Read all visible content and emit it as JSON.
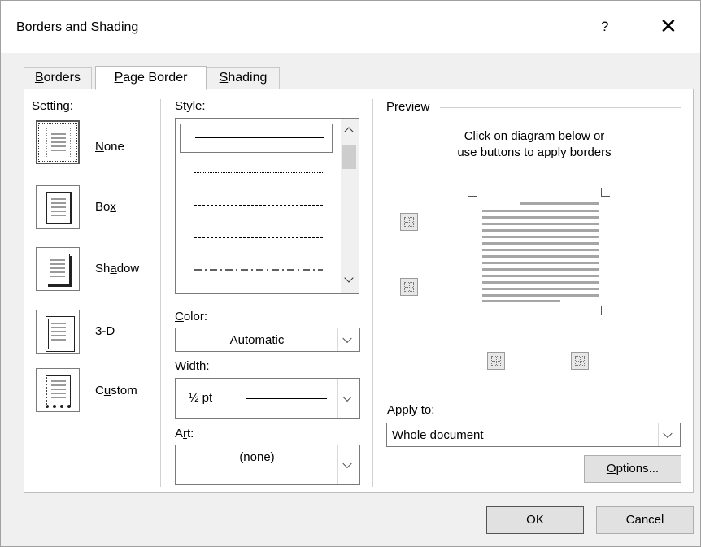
{
  "dialog": {
    "title": "Borders and Shading",
    "help_label": "?",
    "close_label": "✕"
  },
  "tabs": [
    {
      "label_pre": "",
      "label_key": "B",
      "label_post": "orders",
      "active": false
    },
    {
      "label_pre": "",
      "label_key": "P",
      "label_post": "age Border",
      "active": true
    },
    {
      "label_pre": "",
      "label_key": "S",
      "label_post": "hading",
      "active": false
    }
  ],
  "setting": {
    "label": "Setting:",
    "options": [
      {
        "pre": "",
        "key": "N",
        "post": "one",
        "icon": "setting-none-icon",
        "selected": true
      },
      {
        "pre": "Bo",
        "key": "x",
        "post": "",
        "icon": "setting-box-icon",
        "selected": false
      },
      {
        "pre": "Sh",
        "key": "a",
        "post": "dow",
        "icon": "setting-shadow-icon",
        "selected": false
      },
      {
        "pre": "3-",
        "key": "D",
        "post": "",
        "icon": "setting-3d-icon",
        "selected": false
      },
      {
        "pre": "C",
        "key": "u",
        "post": "stom",
        "icon": "setting-custom-icon",
        "selected": false
      }
    ]
  },
  "style": {
    "label_pre": "St",
    "label_key": "y",
    "label_post": "le:",
    "items": [
      "solid",
      "dotted",
      "dashed-small",
      "dashed",
      "dash-dot"
    ],
    "selected_index": 0
  },
  "color": {
    "label_pre": "",
    "label_key": "C",
    "label_post": "olor:",
    "value": "Automatic"
  },
  "width": {
    "label_pre": "",
    "label_key": "W",
    "label_post": "idth:",
    "value": "½ pt"
  },
  "art": {
    "label_pre": "A",
    "label_key": "r",
    "label_post": "t:",
    "value": "(none)"
  },
  "preview": {
    "label": "Preview",
    "hint_line1": "Click on diagram below or",
    "hint_line2": "use buttons to apply borders"
  },
  "apply_to": {
    "label_pre": "Appl",
    "label_key": "y",
    "label_post": " to:",
    "value": "Whole document"
  },
  "buttons": {
    "options_pre": "",
    "options_key": "O",
    "options_post": "ptions...",
    "ok": "OK",
    "cancel": "Cancel"
  }
}
